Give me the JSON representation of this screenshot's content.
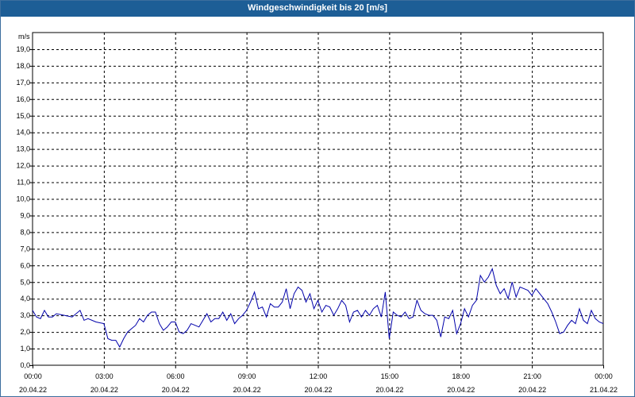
{
  "window": {
    "title": "Windgeschwindigkeit bis 20 [m/s]"
  },
  "chart_data": {
    "type": "line",
    "title": "Windgeschwindigkeit bis 20 [m/s]",
    "ylabel": "m/s",
    "ylim": [
      0,
      20
    ],
    "grid": true,
    "y_ticks": [
      "0,0",
      "1,0",
      "2,0",
      "3,0",
      "4,0",
      "5,0",
      "6,0",
      "7,0",
      "8,0",
      "9,0",
      "10,0",
      "11,0",
      "12,0",
      "13,0",
      "14,0",
      "15,0",
      "16,0",
      "17,0",
      "18,0",
      "19,0"
    ],
    "x_ticks": [
      {
        "time": "00:00",
        "date": "20.04.22"
      },
      {
        "time": "03:00",
        "date": "20.04.22"
      },
      {
        "time": "06:00",
        "date": "20.04.22"
      },
      {
        "time": "09:00",
        "date": "20.04.22"
      },
      {
        "time": "12:00",
        "date": "20.04.22"
      },
      {
        "time": "15:00",
        "date": "20.04.22"
      },
      {
        "time": "18:00",
        "date": "20.04.22"
      },
      {
        "time": "21:00",
        "date": "20.04.22"
      },
      {
        "time": "00:00",
        "date": "21.04.22"
      }
    ],
    "line_color": "#0000aa",
    "series": [
      {
        "times": [
          "00:00",
          "00:10",
          "00:20",
          "00:30",
          "00:40",
          "00:50",
          "01:00",
          "01:20",
          "01:40",
          "02:00",
          "02:10",
          "02:20",
          "02:40",
          "03:00",
          "03:10",
          "03:20",
          "03:30",
          "03:40",
          "03:50",
          "04:00",
          "04:10",
          "04:20",
          "04:30",
          "04:40",
          "04:50",
          "05:00",
          "05:10",
          "05:20",
          "05:30",
          "05:40",
          "05:50",
          "06:00",
          "06:10",
          "06:20",
          "06:30",
          "06:40",
          "06:50",
          "07:00",
          "07:10",
          "07:20",
          "07:30",
          "07:40",
          "07:50",
          "08:00",
          "08:10",
          "08:20",
          "08:30",
          "08:40",
          "08:50",
          "09:00",
          "09:10",
          "09:20",
          "09:30",
          "09:40",
          "09:50",
          "10:00",
          "10:10",
          "10:20",
          "10:30",
          "10:40",
          "10:50",
          "11:00",
          "11:10",
          "11:20",
          "11:30",
          "11:40",
          "11:50",
          "12:00",
          "12:10",
          "12:20",
          "12:30",
          "12:40",
          "12:50",
          "13:00",
          "13:10",
          "13:20",
          "13:30",
          "13:40",
          "13:50",
          "14:00",
          "14:10",
          "14:20",
          "14:30",
          "14:40",
          "14:50",
          "15:00",
          "15:10",
          "15:20",
          "15:30",
          "15:40",
          "15:50",
          "16:00",
          "16:10",
          "16:20",
          "16:30",
          "16:40",
          "16:50",
          "17:00",
          "17:10",
          "17:20",
          "17:30",
          "17:40",
          "17:50",
          "18:00",
          "18:10",
          "18:20",
          "18:30",
          "18:40",
          "18:50",
          "19:00",
          "19:10",
          "19:20",
          "19:30",
          "19:40",
          "19:50",
          "20:00",
          "20:10",
          "20:20",
          "20:30",
          "20:40",
          "20:50",
          "21:00",
          "21:10",
          "21:20",
          "21:30",
          "21:40",
          "21:50",
          "22:00",
          "22:10",
          "22:20",
          "22:30",
          "22:40",
          "22:50",
          "23:00",
          "23:10",
          "23:20",
          "23:30",
          "23:40",
          "23:50",
          "24:00"
        ],
        "values": [
          3.3,
          2.9,
          2.8,
          3.3,
          2.9,
          2.9,
          3.1,
          3.0,
          2.9,
          3.3,
          2.7,
          2.8,
          2.6,
          2.5,
          1.6,
          1.5,
          1.5,
          1.1,
          1.6,
          2.0,
          2.2,
          2.4,
          2.8,
          2.6,
          3.0,
          3.2,
          3.2,
          2.5,
          2.1,
          2.3,
          2.6,
          2.6,
          2.0,
          1.9,
          2.1,
          2.5,
          2.4,
          2.3,
          2.7,
          3.1,
          2.6,
          2.8,
          2.8,
          3.2,
          2.7,
          3.1,
          2.5,
          2.8,
          3.0,
          3.3,
          3.8,
          4.4,
          3.4,
          3.5,
          2.9,
          3.7,
          3.5,
          3.5,
          3.8,
          4.6,
          3.4,
          4.3,
          4.7,
          4.5,
          3.8,
          4.3,
          3.4,
          3.9,
          3.2,
          3.6,
          3.5,
          3.0,
          3.4,
          3.9,
          3.6,
          2.6,
          3.2,
          3.3,
          2.9,
          3.3,
          3.0,
          3.4,
          3.6,
          2.9,
          4.4,
          1.6,
          3.2,
          3.0,
          2.9,
          3.2,
          2.8,
          2.9,
          3.9,
          3.3,
          3.1,
          3.0,
          3.0,
          2.7,
          1.7,
          2.9,
          2.8,
          3.3,
          1.9,
          2.5,
          3.4,
          2.9,
          3.6,
          3.9,
          5.4,
          5.0,
          5.3,
          5.8,
          4.8,
          4.3,
          4.6,
          4.0,
          5.0,
          4.1,
          4.7,
          4.6,
          4.5,
          4.2,
          4.6,
          4.3,
          4.0,
          3.7,
          3.2,
          2.6,
          1.9,
          2.0,
          2.4,
          2.7,
          2.5,
          3.4,
          2.7,
          2.5,
          3.3,
          2.8,
          2.6,
          2.5,
          2.9
        ]
      }
    ]
  }
}
